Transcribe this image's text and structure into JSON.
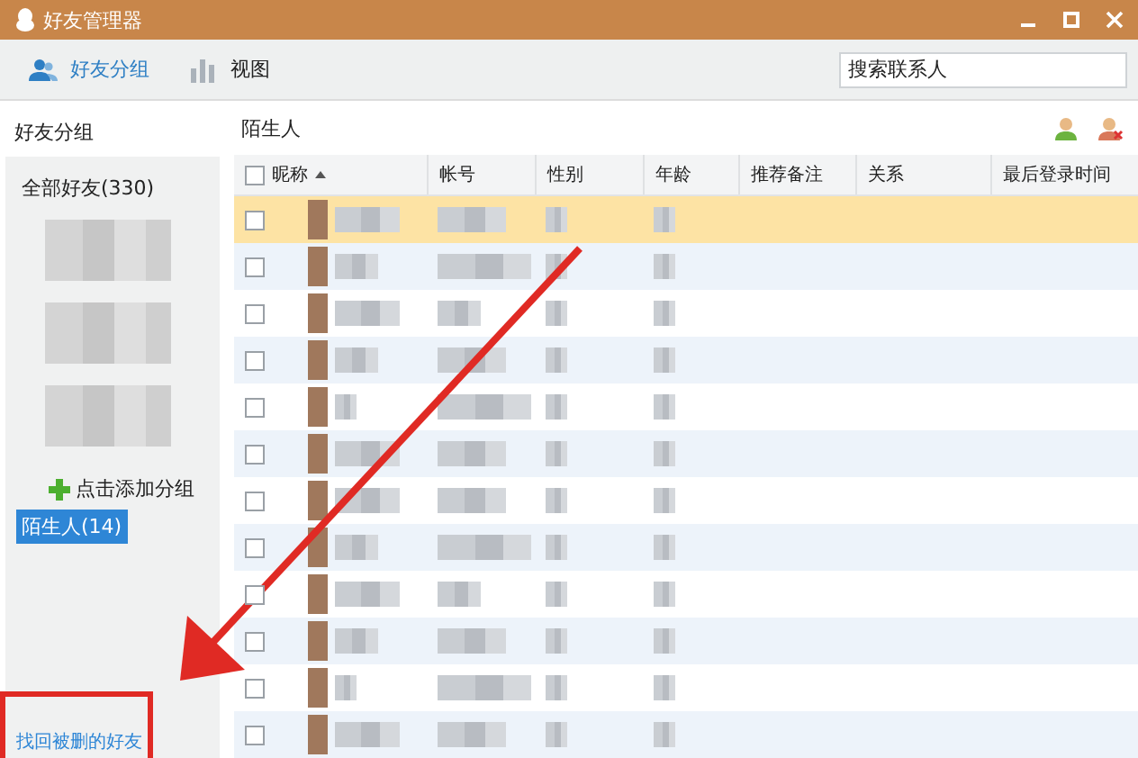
{
  "window": {
    "title": "好友管理器"
  },
  "toolbar": {
    "tabs": [
      {
        "label": "好友分组",
        "selected": true
      },
      {
        "label": "视图",
        "selected": false
      }
    ],
    "search": {
      "placeholder": "搜索联系人"
    }
  },
  "sidebar": {
    "title": "好友分组",
    "items": [
      {
        "kind": "group",
        "label": "全部好友(330)",
        "selected": false
      },
      {
        "kind": "blurred",
        "selected": false
      },
      {
        "kind": "blurred",
        "selected": false
      },
      {
        "kind": "blurred",
        "selected": false
      },
      {
        "kind": "add",
        "label": "点击添加分组",
        "selected": false
      },
      {
        "kind": "group",
        "label": "陌生人(14)",
        "selected": true
      }
    ],
    "recover_link": "找回被删的好友"
  },
  "main": {
    "title": "陌生人",
    "table": {
      "all_checked": false,
      "columns": [
        {
          "label": "昵称",
          "sorted": true
        },
        {
          "label": "帐号",
          "sorted": false
        },
        {
          "label": "性别",
          "sorted": false
        },
        {
          "label": "年龄",
          "sorted": false
        },
        {
          "label": "推荐备注",
          "sorted": false
        },
        {
          "label": "关系",
          "sorted": false
        },
        {
          "label": "最后登录时间",
          "sorted": false
        }
      ],
      "rows": [
        {
          "selected": true,
          "checked": false
        },
        {
          "selected": false,
          "checked": false
        },
        {
          "selected": false,
          "checked": false
        },
        {
          "selected": false,
          "checked": false
        },
        {
          "selected": false,
          "checked": false
        },
        {
          "selected": false,
          "checked": false
        },
        {
          "selected": false,
          "checked": false
        },
        {
          "selected": false,
          "checked": false
        },
        {
          "selected": false,
          "checked": false
        },
        {
          "selected": false,
          "checked": false
        },
        {
          "selected": false,
          "checked": false
        },
        {
          "selected": false,
          "checked": false
        }
      ]
    }
  },
  "annotations": {
    "arrow": true,
    "box": true
  }
}
